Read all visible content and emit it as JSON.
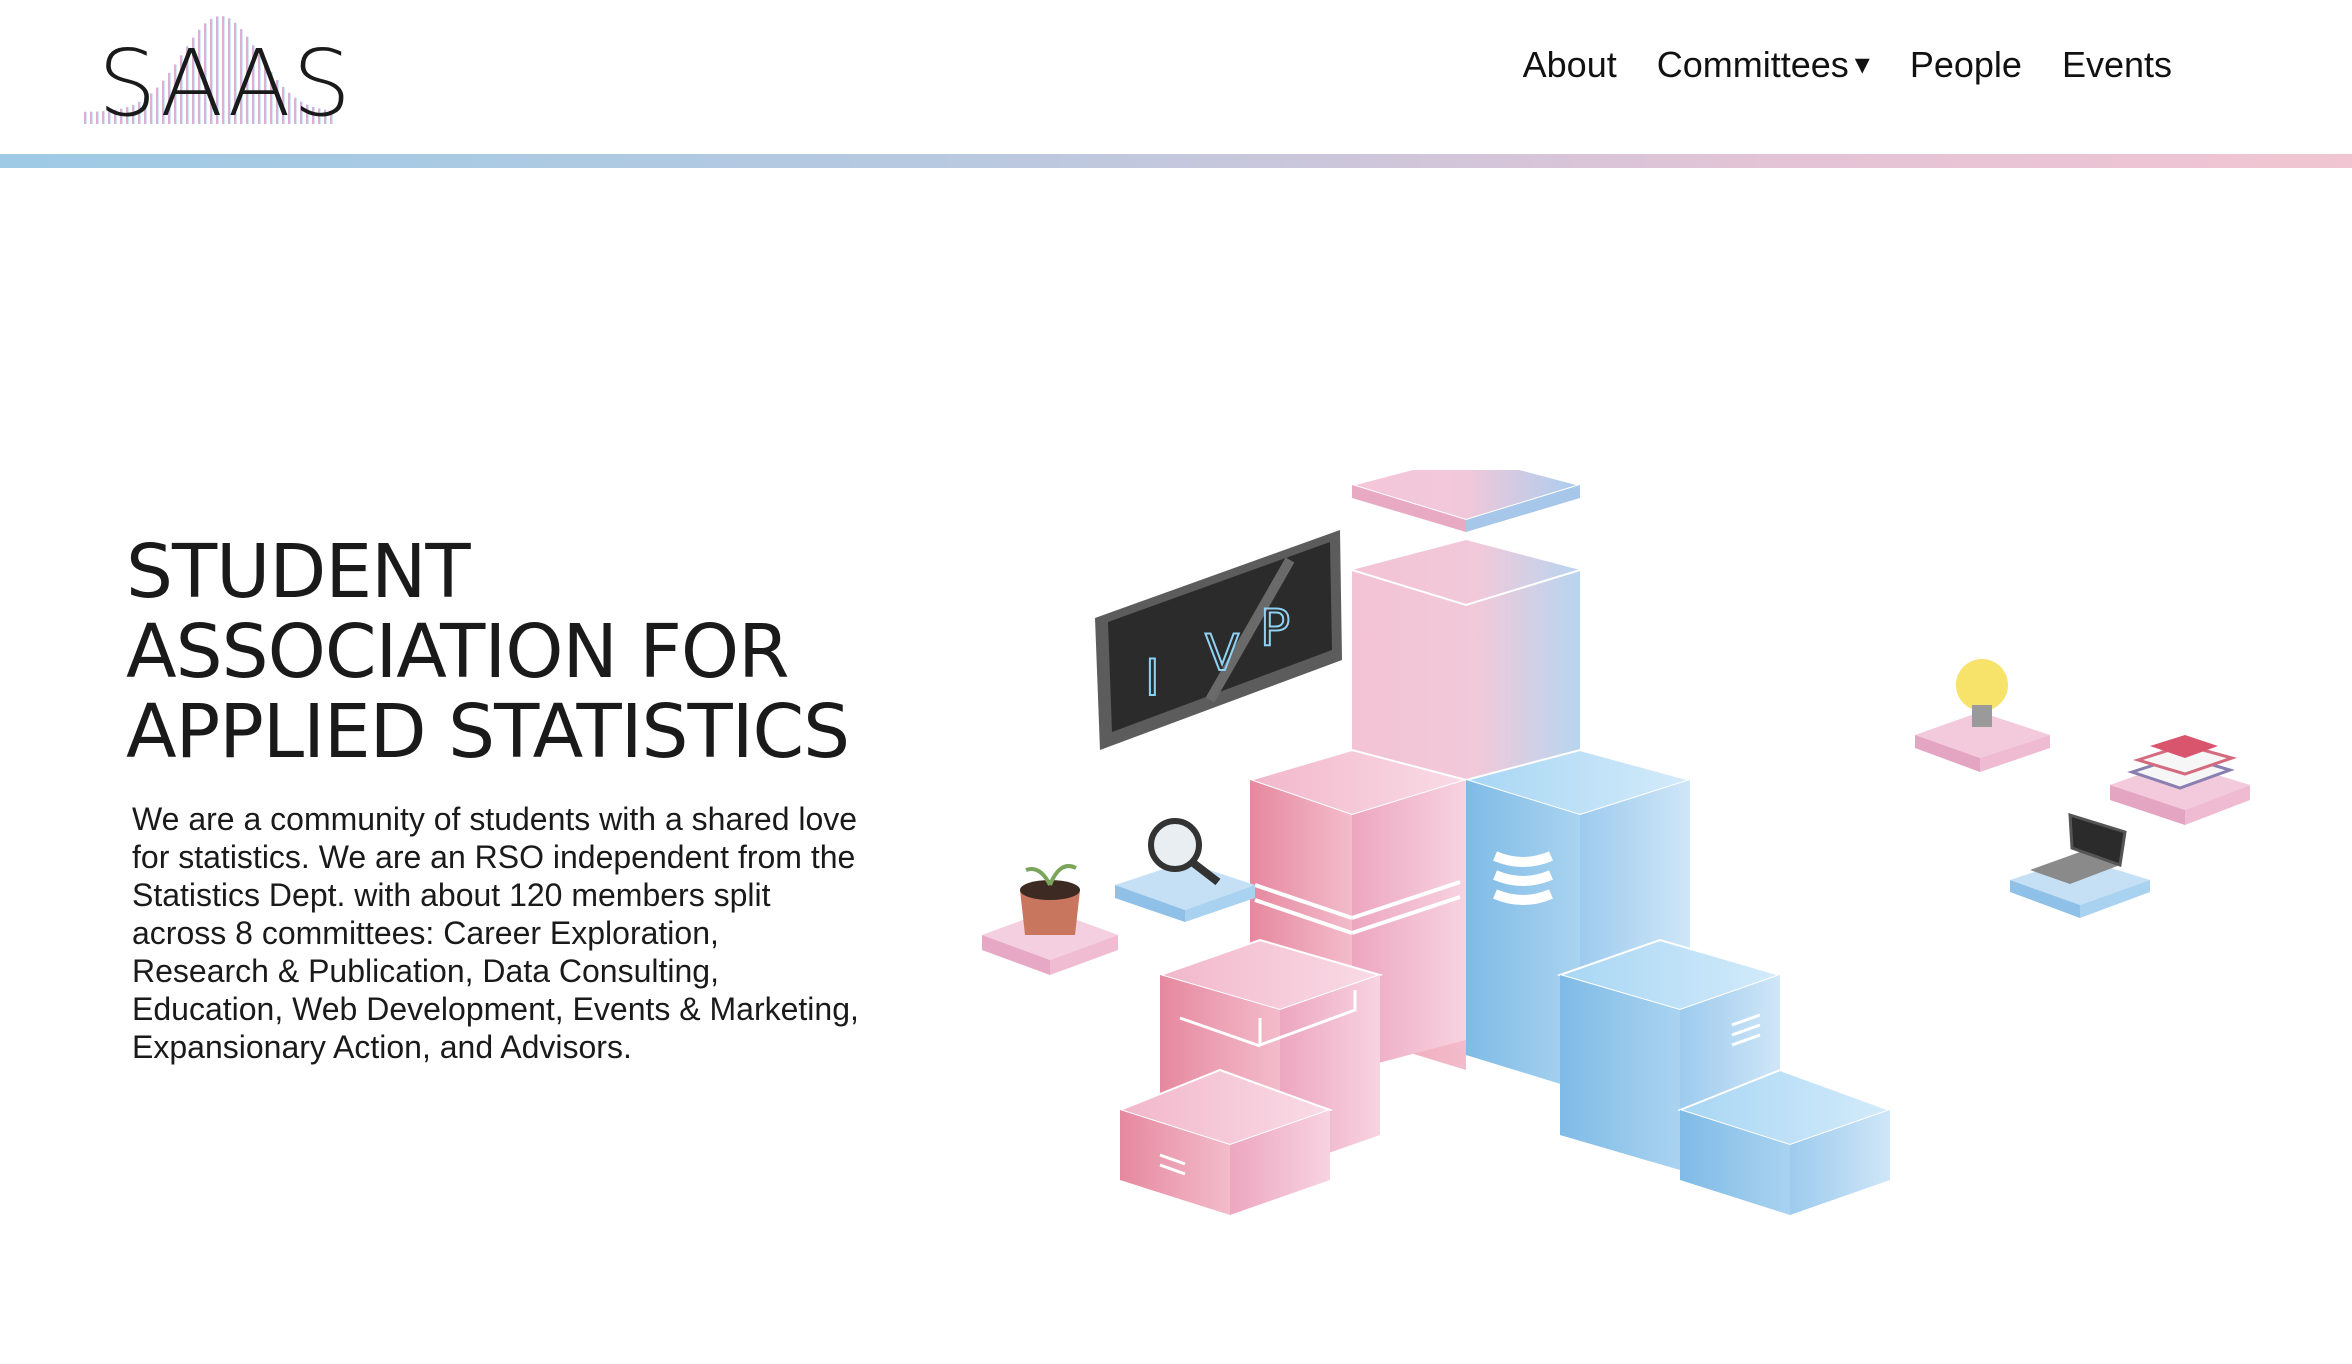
{
  "logo": {
    "text": "SAAS",
    "icon": "bar-spectrum-logo"
  },
  "nav": {
    "items": [
      {
        "label": "About"
      },
      {
        "label": "Committees",
        "caret": "▾"
      },
      {
        "label": "People"
      },
      {
        "label": "Events"
      }
    ]
  },
  "hero": {
    "title_lines": [
      "STUDENT",
      "ASSOCIATION FOR",
      "APPLIED STATISTICS"
    ],
    "description": "We are a community of students with a shared love for statistics. We are an RSO independent from the Statistics Dept. with about 120 members split across 8 committees: Career Exploration, Research & Publication, Data Consulting, Education, Web Development, Events & Marketing, Expansionary Action, and Advisors."
  },
  "illustration": {
    "screen_letters": [
      "I",
      "V",
      "P"
    ],
    "icons": [
      "monitor-icon",
      "plant-icon",
      "magnifier-icon",
      "lightbulb-icon",
      "books-icon",
      "laptop-icon"
    ]
  },
  "colors": {
    "pink": "#f0a7c3",
    "blue": "#9fd0f0",
    "bar_start": "#9ecae6",
    "bar_end": "#f1c5d2",
    "text": "#1a1a1a"
  }
}
